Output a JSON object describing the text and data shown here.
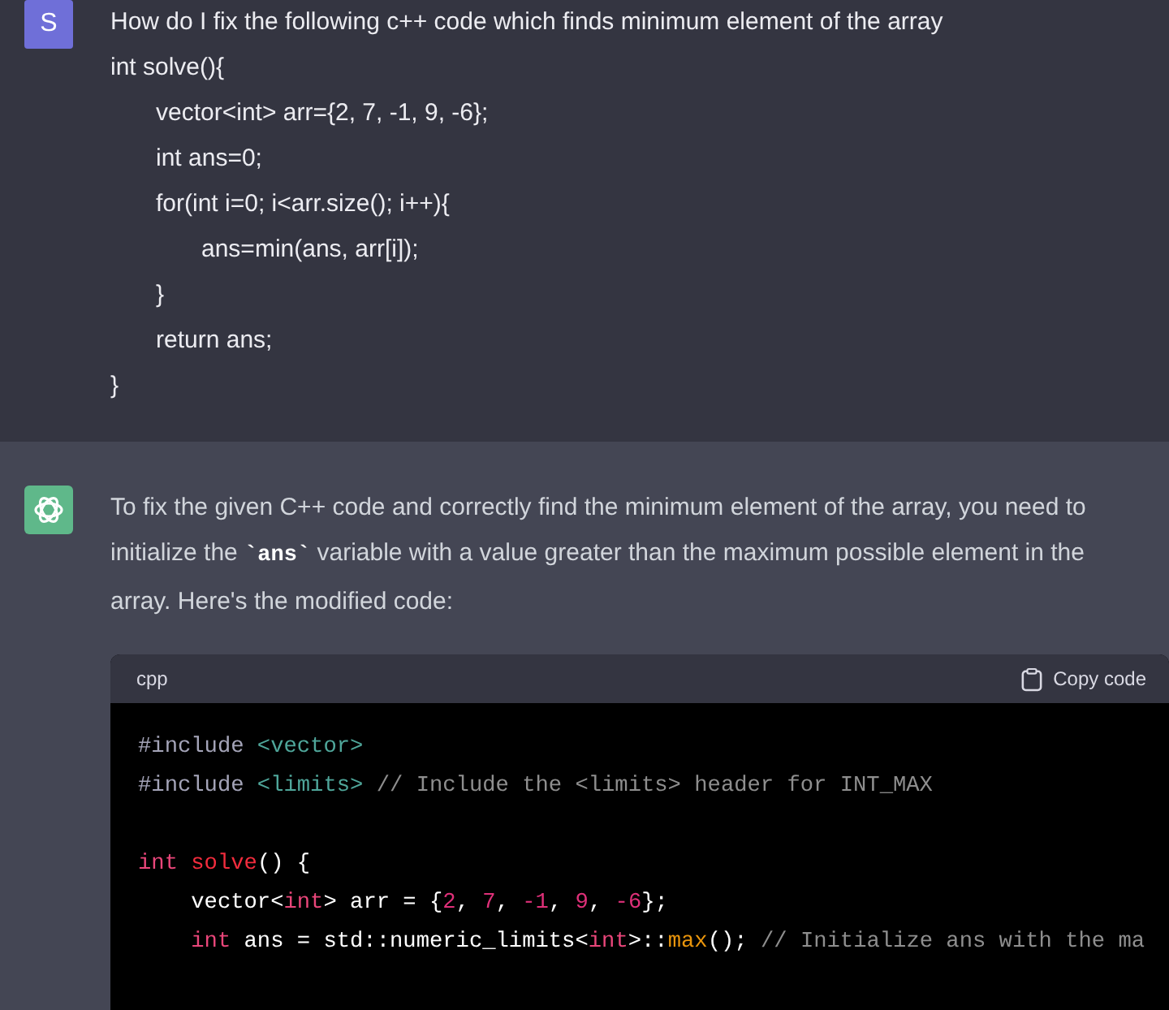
{
  "question": {
    "avatar": "S",
    "lines": [
      {
        "text": "How do I fix the following c++ code which finds minimum element of the array"
      },
      {
        "text": "int solve(){",
        "children": [
          {
            "text": "vector<int> arr={2, 7, -1, 9, -6};"
          },
          {
            "text": "int ans=0;"
          },
          {
            "text": "for(int i=0; i<arr.size(); i++){",
            "children": [
              {
                "text": "ans=min(ans, arr[i]);"
              }
            ]
          },
          {
            "text": "}"
          },
          {
            "text": "return ans;"
          }
        ]
      },
      {
        "text": "}"
      }
    ]
  },
  "answer": {
    "paragraph": [
      {
        "kind": "text",
        "text": "To fix the given C++ code and correctly find the minimum element of the array, you need to initialize the "
      },
      {
        "kind": "code",
        "text": "`ans`"
      },
      {
        "kind": "text",
        "text": " variable with a value greater than the maximum possible element in the array. Here's the modified code:"
      }
    ],
    "code_block": {
      "language": "cpp",
      "copy_label": "Copy code",
      "blocks": [
        [
          [
            {
              "kind": "preproc",
              "text": "#include "
            },
            {
              "kind": "string",
              "text": "<vector>"
            }
          ],
          [
            {
              "kind": "preproc",
              "text": "#include "
            },
            {
              "kind": "string",
              "text": "<limits>"
            },
            {
              "kind": "comment",
              "text": " // Include the <limits> header for INT_MAX"
            }
          ]
        ],
        [
          [
            {
              "kind": "keyword",
              "text": "int "
            },
            {
              "kind": "function",
              "text": "solve"
            },
            {
              "kind": "plain",
              "text": "() {"
            }
          ],
          [
            {
              "kind": "plain",
              "text": "    vector<"
            },
            {
              "kind": "keyword",
              "text": "int"
            },
            {
              "kind": "plain",
              "text": "> arr = {"
            },
            {
              "kind": "number",
              "text": "2"
            },
            {
              "kind": "plain",
              "text": ", "
            },
            {
              "kind": "number",
              "text": "7"
            },
            {
              "kind": "plain",
              "text": ", "
            },
            {
              "kind": "number",
              "text": "-1"
            },
            {
              "kind": "plain",
              "text": ", "
            },
            {
              "kind": "number",
              "text": "9"
            },
            {
              "kind": "plain",
              "text": ", "
            },
            {
              "kind": "number",
              "text": "-6"
            },
            {
              "kind": "plain",
              "text": "};"
            }
          ],
          [
            {
              "kind": "keyword",
              "text": "    int"
            },
            {
              "kind": "plain",
              "text": " ans = std::numeric_limits<"
            },
            {
              "kind": "keyword",
              "text": "int"
            },
            {
              "kind": "plain",
              "text": ">::"
            },
            {
              "kind": "builtin",
              "text": "max"
            },
            {
              "kind": "plain",
              "text": "(); "
            },
            {
              "kind": "comment",
              "text": "// Initialize ans with the ma"
            }
          ]
        ]
      ]
    }
  }
}
